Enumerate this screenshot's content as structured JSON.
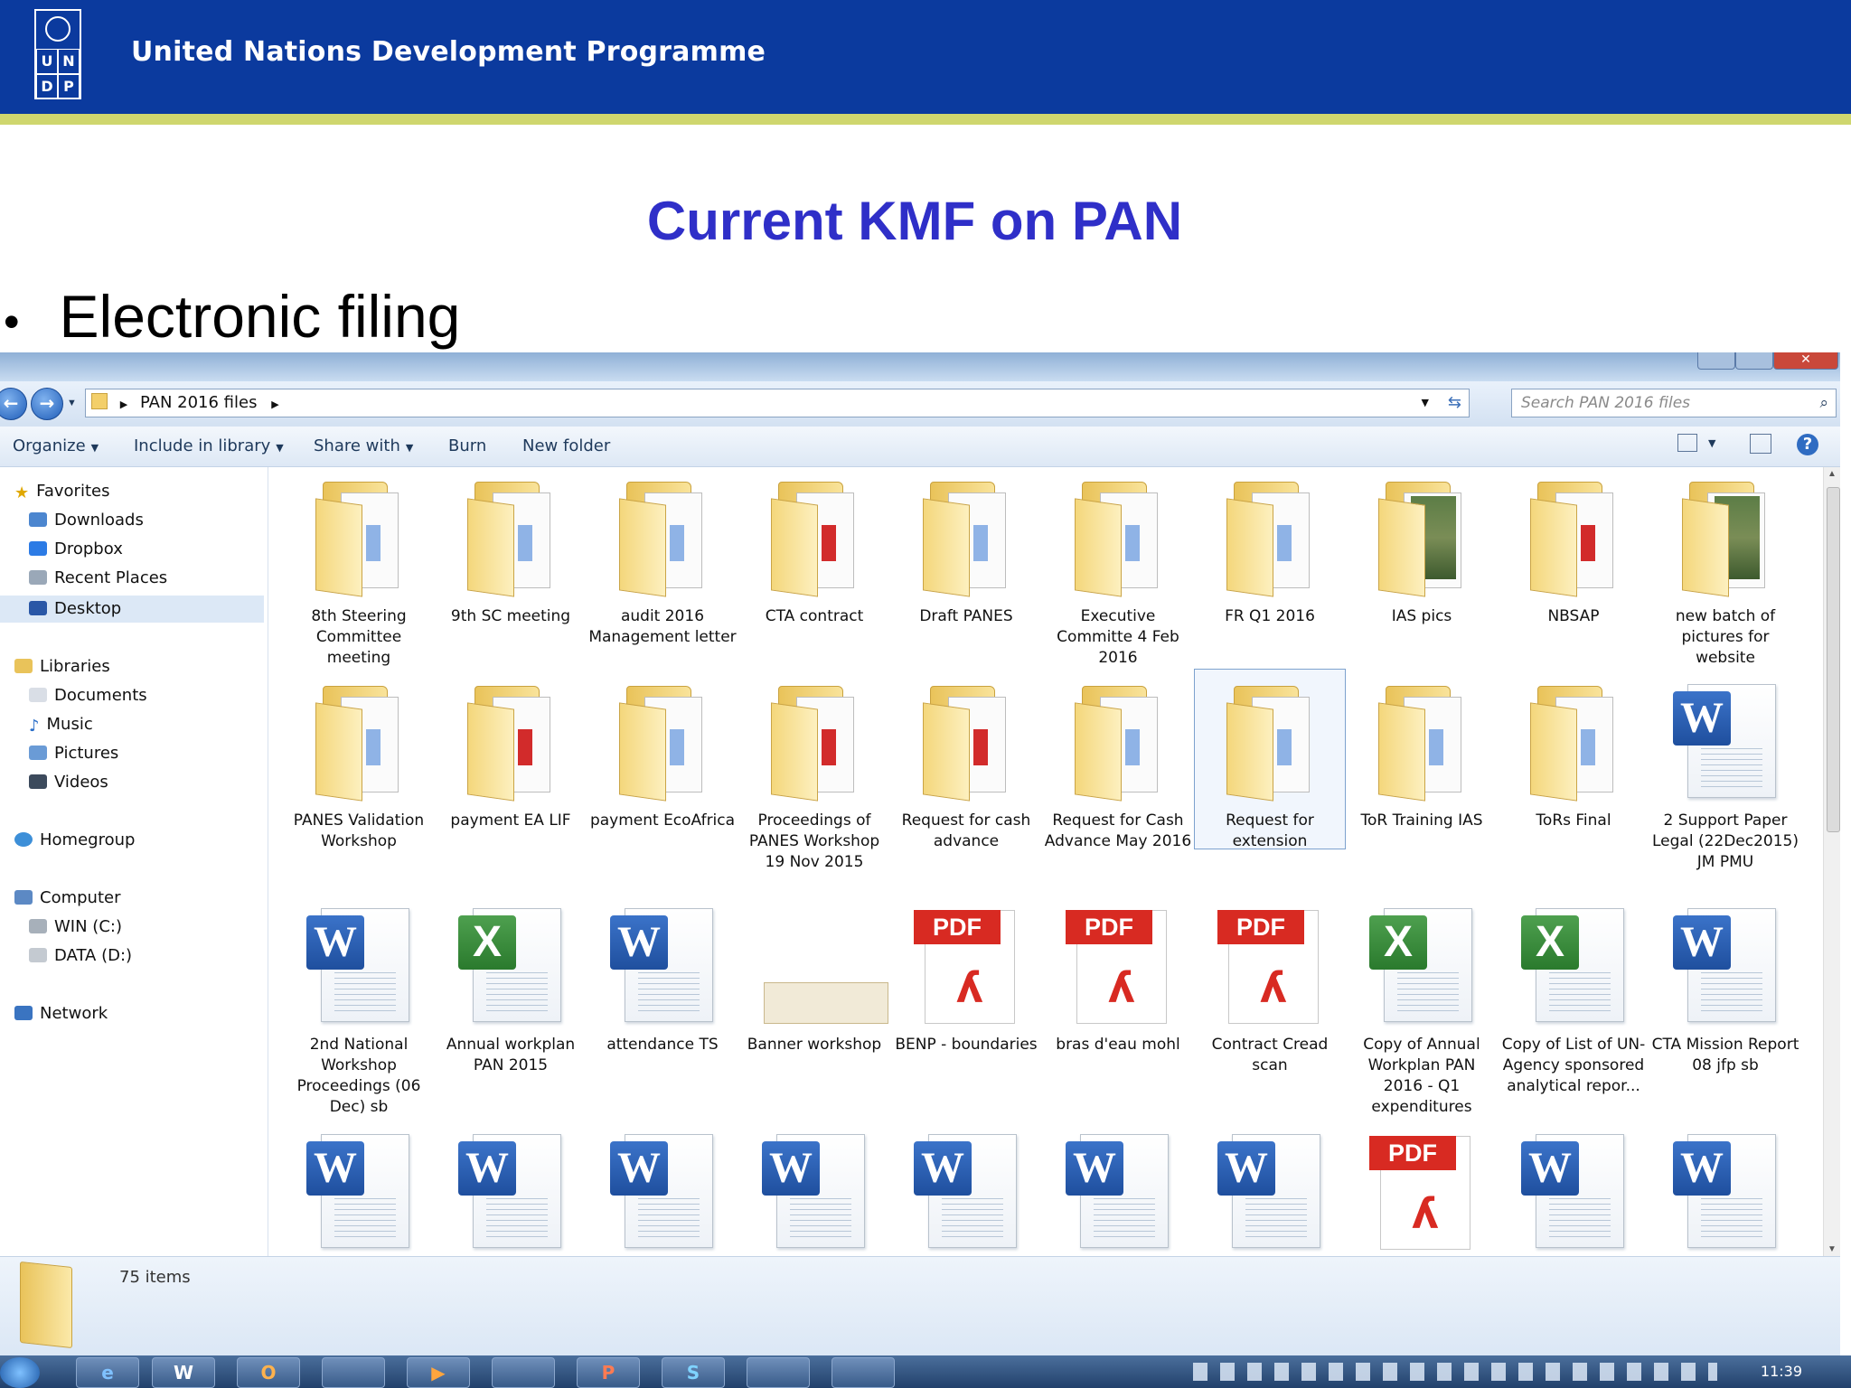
{
  "slide": {
    "org": "United Nations Development Programme",
    "logo_letters": [
      "U",
      "N",
      "D",
      "P"
    ],
    "title": "Current KMF on PAN",
    "bullet": "Electronic filing"
  },
  "explorer": {
    "address": "PAN 2016 files",
    "search_placeholder": "Search PAN 2016 files",
    "toolbar": {
      "organize": "Organize",
      "include": "Include in library",
      "share": "Share with",
      "burn": "Burn",
      "new_folder": "New folder"
    },
    "nav": {
      "favorites": "Favorites",
      "downloads": "Downloads",
      "dropbox": "Dropbox",
      "recent": "Recent Places",
      "desktop": "Desktop",
      "libraries": "Libraries",
      "documents": "Documents",
      "music": "Music",
      "pictures": "Pictures",
      "videos": "Videos",
      "homegroup": "Homegroup",
      "computer": "Computer",
      "win_c": "WIN (C:)",
      "data_d": "DATA (D:)",
      "network": "Network"
    },
    "items": [
      "8th Steering Committee meeting",
      "9th SC meeting",
      "audit 2016 Management letter",
      "CTA contract",
      "Draft PANES",
      "Executive Committe 4 Feb 2016",
      "FR Q1 2016",
      "IAS pics",
      "NBSAP",
      "new batch of pictures for website",
      "PANES Validation Workshop",
      "payment EA LIF",
      "payment EcoAfrica",
      "Proceedings of PANES Workshop 19 Nov 2015",
      "Request for cash advance",
      "Request for Cash Advance May 2016",
      "Request for extension",
      "ToR Training IAS",
      "ToRs Final",
      "2 Support Paper Legal (22Dec2015) JM PMU",
      "2nd National Workshop Proceedings (06 Dec) sb",
      "Annual workplan PAN 2015",
      "attendance TS",
      "Banner workshop",
      "BENP - boundaries",
      "bras d'eau mohl",
      "Contract Cread scan",
      "Copy of Annual Workplan PAN 2016 - Q1 expenditures",
      "Copy of List of UN-Agency sponsored analytical repor...",
      "CTA Mission Report 08  jfp sb"
    ],
    "badges": {
      "word": "W",
      "excel": "X",
      "pdf": "PDF",
      "pdf_mark": "ʎ"
    },
    "status": "75 items"
  },
  "taskbar": {
    "apps": [
      "W",
      "O",
      "",
      "▶",
      "",
      "P",
      "S",
      "",
      ""
    ],
    "clock": "11:39"
  },
  "colors": {
    "banner": "#0b3a9e",
    "title": "#2f2fc8",
    "accent_line": "#cfd66e"
  }
}
